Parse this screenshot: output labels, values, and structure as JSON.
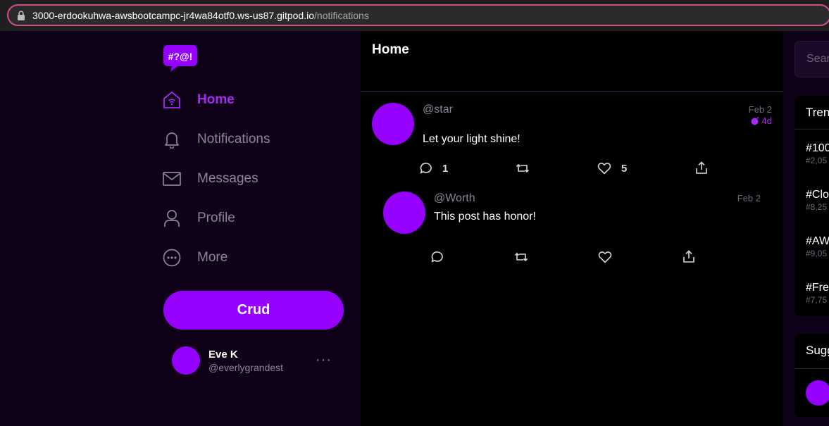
{
  "browser": {
    "url_host": "3000-erdookuhwa-awsbootcampc-jr4wa84otf0.ws-us87.gitpod.io",
    "url_path": "/notifications"
  },
  "colors": {
    "brand": "#9500ff",
    "brand_text": "#a52af0",
    "background": "#0f0117",
    "url_border": "#d24d8a"
  },
  "sidebar": {
    "logo_icon": "speech-bubble-logo-icon",
    "items": [
      {
        "label": "Home",
        "icon": "home-icon",
        "active": true
      },
      {
        "label": "Notifications",
        "icon": "bell-icon",
        "active": false
      },
      {
        "label": "Messages",
        "icon": "envelope-icon",
        "active": false
      },
      {
        "label": "Profile",
        "icon": "person-icon",
        "active": false
      },
      {
        "label": "More",
        "icon": "more-circle-icon",
        "active": false
      }
    ],
    "crud_label": "Crud",
    "profile": {
      "name": "Eve K",
      "handle": "@everlygrandest",
      "more": "···"
    }
  },
  "main": {
    "title": "Home",
    "posts": [
      {
        "handle": "@star",
        "date": "Feb 2",
        "ago": "4d",
        "message": "Let your light shine!",
        "reply_count": "1",
        "repost_count": "",
        "like_count": "5"
      },
      {
        "handle": "@Worth",
        "date": "Feb 2",
        "message": "This post has honor!",
        "reply_count": "",
        "repost_count": "",
        "like_count": ""
      }
    ]
  },
  "right": {
    "search_placeholder": "Sear",
    "trending_title": "Tren",
    "trends": [
      {
        "tag": "#100",
        "count": "#2,05"
      },
      {
        "tag": "#Clo",
        "count": "#8,25"
      },
      {
        "tag": "#AW",
        "count": "#9,05"
      },
      {
        "tag": "#Fre",
        "count": "#7,75"
      }
    ],
    "suggested_title": "Sugg"
  }
}
